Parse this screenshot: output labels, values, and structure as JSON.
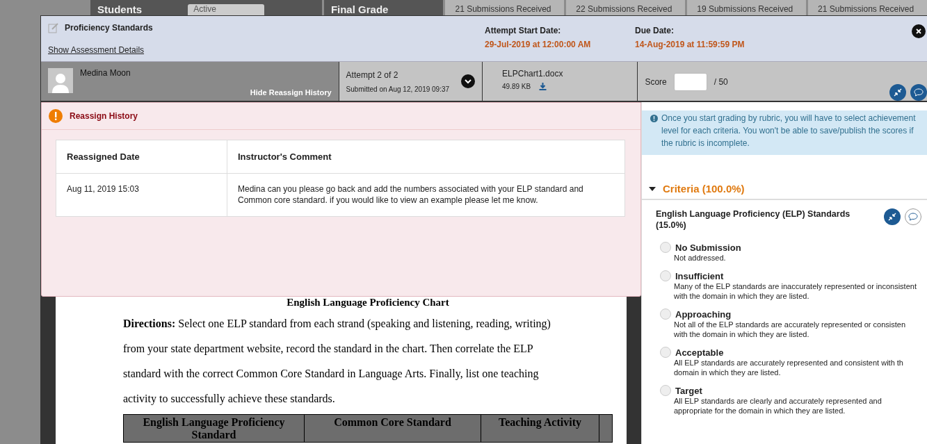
{
  "background": {
    "students_label": "Students",
    "status_select": "Active",
    "tiles": [
      {
        "title": "Final Grade"
      },
      {
        "subtitle": "21 Submissions Received"
      },
      {
        "subtitle": "22 Submissions Received"
      },
      {
        "subtitle": "19 Submissions Received"
      },
      {
        "subtitle": "21 Submissions Received"
      }
    ]
  },
  "header": {
    "title": "Proficiency Standards",
    "details_link": "Show Assessment Details",
    "dates": [
      {
        "label": "Attempt Start Date:",
        "value": "29-Jul-2019 at 12:00:00 AM"
      },
      {
        "label": "Due Date:",
        "value": "14-Aug-2019 at 11:59:59 PM"
      }
    ]
  },
  "student": {
    "name": "Medina Moon",
    "history_link": "Hide Reassign History"
  },
  "attempt": {
    "label": "Attempt 2 of 2",
    "submitted": "Submitted on Aug 12, 2019 09:37"
  },
  "file": {
    "name": "ELPChart1.docx",
    "size": "49.89 KB"
  },
  "score": {
    "label": "Score",
    "total": "/ 50"
  },
  "reassign_history": {
    "title": "Reassign History",
    "columns": [
      "Reassigned Date",
      "Instructor's Comment"
    ],
    "rows": [
      [
        "Aug 11, 2019 15:03",
        "Medina can you please go back and add the numbers associated with your ELP standard and Common core standard. if you would like to view an example please let me know."
      ]
    ]
  },
  "document": {
    "title": "English Language Proficiency Chart",
    "paragraph": "**Directions:**  Select one ELP standard from each strand (speaking and listening, reading, writing) from your state department website, record the standard in the chart.  Then correlate the ELP standard with the correct Common Core Standard in Language Arts. Finally, list one teaching activity to successfully achieve these standards.",
    "table_columns": [
      "English Language Proficiency Standard",
      "Common Core Standard",
      "Teaching Activity"
    ]
  },
  "rubric": {
    "notice": "Once you start grading by rubric, you will have to select achievement level for each criteria. You won't be able to save/publish the scores if the rubric is incomplete.",
    "criteria_heading": "Criteria (100.0%)",
    "expanded": true,
    "criterion": "English Language Proficiency (ELP) Standards (15.0%)",
    "levels": [
      {
        "name": "No Submission",
        "description": "Not addressed.",
        "selected": false
      },
      {
        "name": "Insufficient",
        "description": "Many of the ELP standards are inaccurately represented or inconsistent with the domain in which they are listed.",
        "selected": false
      },
      {
        "name": "Approaching",
        "description": "Not all of the ELP standards are accurately represented or consisten with the domain in which they are listed.",
        "selected": false
      },
      {
        "name": "Acceptable",
        "description": "All ELP standards are accurately represented and consistent with th domain in which they are listed.",
        "selected": false
      },
      {
        "name": "Target",
        "description": "All ELP standards are clearly and accurately represented and appropriate for the domain in which they are listed.",
        "selected": false
      }
    ]
  }
}
